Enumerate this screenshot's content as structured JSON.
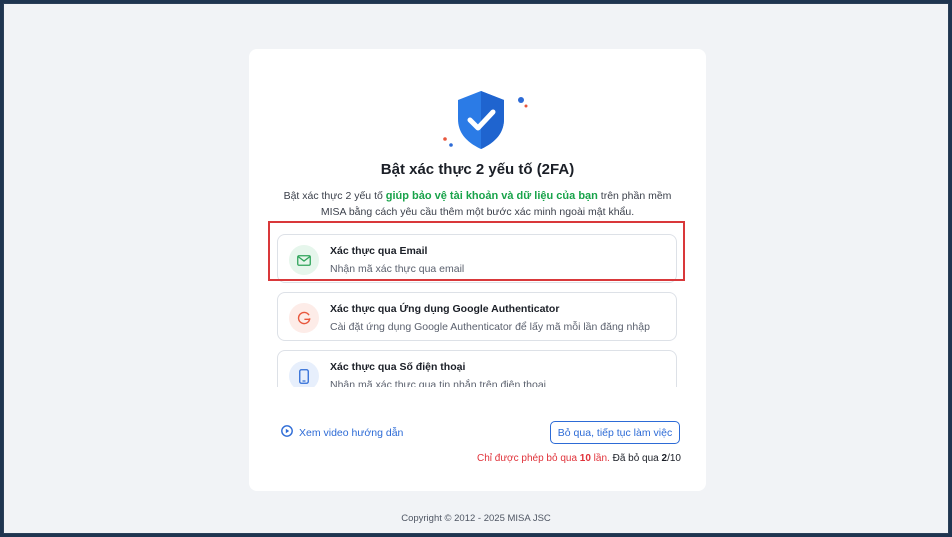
{
  "title": "Bật xác thực 2 yếu tố (2FA)",
  "description": {
    "before": "Bật xác thực 2 yếu tố ",
    "highlight": "giúp bảo vệ tài khoản và dữ liệu của bạn",
    "after": " trên phần mềm MISA bằng cách yêu cầu thêm một bước xác minh ngoài mật khẩu."
  },
  "options": [
    {
      "title": "Xác thực qua Email",
      "subtitle": "Nhận mã xác thực qua email",
      "icon": "mail-icon",
      "color": "#2fa45a",
      "bg": "#e6f6ec"
    },
    {
      "title": "Xác thực qua Ứng dụng Google Authenticator",
      "subtitle": "Cài đặt ứng dụng Google Authenticator để lấy mã mỗi lần đăng nhập",
      "icon": "google-icon",
      "color": "#e8573d",
      "bg": "#fdece8"
    },
    {
      "title": "Xác thực qua Số điện thoại",
      "subtitle": "Nhận mã xác thực qua tin nhắn trên điện thoại",
      "icon": "phone-icon",
      "color": "#2d6bd6",
      "bg": "#e7effc"
    }
  ],
  "video_link": "Xem video hướng dẫn",
  "skip_button": "Bỏ qua, tiếp tục làm việc",
  "skip_note": {
    "prefix": "Chỉ được phép bỏ qua ",
    "limit": "10",
    "suffix": " lần.",
    "count_prefix": " Đã bỏ qua ",
    "count": "2",
    "count_suffix": "/10"
  },
  "copyright": "Copyright © 2012 - 2025 MISA JSC",
  "colors": {
    "accent": "#2d6bd6",
    "success": "#18a34a",
    "danger": "#e0323a"
  }
}
